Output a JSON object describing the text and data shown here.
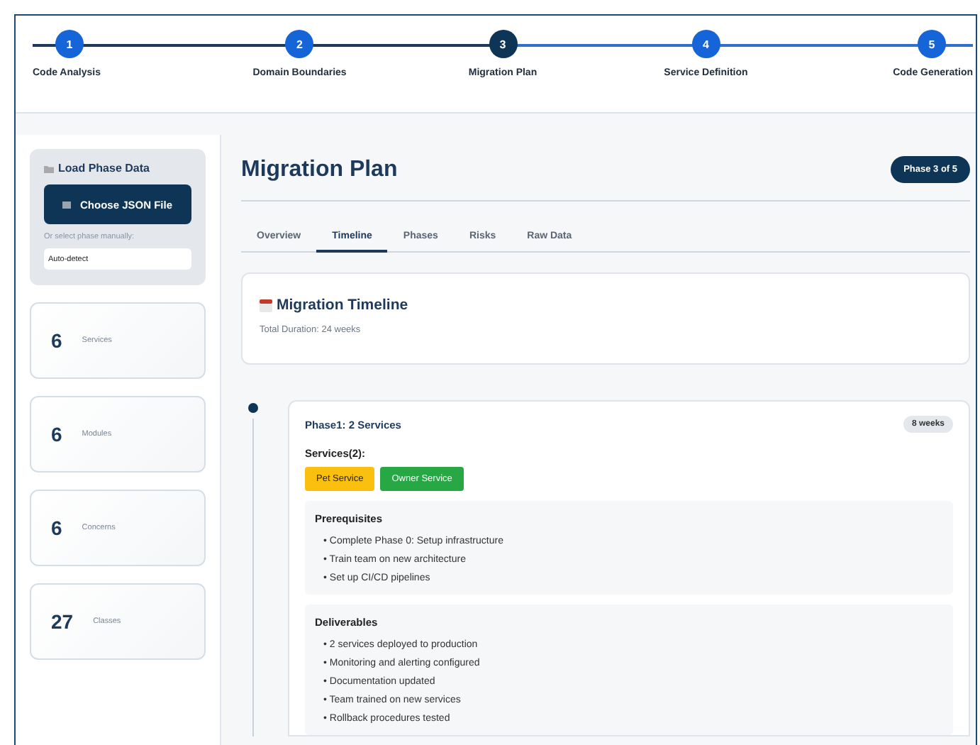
{
  "steps": [
    {
      "number": "1",
      "label": "Code Analysis",
      "selected": false
    },
    {
      "number": "2",
      "label": "Domain Boundaries",
      "selected": false
    },
    {
      "number": "3",
      "label": "Migration Plan",
      "selected": true
    },
    {
      "number": "4",
      "label": "Service Definition",
      "selected": false
    },
    {
      "number": "5",
      "label": "Code Generation",
      "selected": false
    }
  ],
  "sidebar": {
    "load_panel": {
      "title": "Load Phase Data",
      "button": "Choose JSON File",
      "select_label": "Or select phase manually:",
      "select_value": "Auto-detect"
    },
    "stats": [
      {
        "value": "6",
        "label": "Services"
      },
      {
        "value": "6",
        "label": "Modules"
      },
      {
        "value": "6",
        "label": "Concerns"
      },
      {
        "value": "27",
        "label": "Classes"
      }
    ]
  },
  "main": {
    "title": "Migration Plan",
    "badge": "Phase 3 of 5",
    "tabs": [
      {
        "label": "Overview",
        "selected": false
      },
      {
        "label": "Timeline",
        "selected": true
      },
      {
        "label": "Phases",
        "selected": false
      },
      {
        "label": "Risks",
        "selected": false
      },
      {
        "label": "Raw Data",
        "selected": false
      }
    ],
    "timeline_card": {
      "title": "Migration Timeline",
      "duration": "Total Duration: 24 weeks"
    },
    "phase": {
      "title": "Phase1: 2 Services",
      "duration": "8 weeks",
      "services_label": "Services(2):",
      "services": [
        {
          "name": "Pet Service",
          "color": "#fbbf0f"
        },
        {
          "name": "Owner Service",
          "color": "#28a745"
        }
      ],
      "sections": [
        {
          "title": "Prerequisites",
          "items": [
            "• Complete Phase 0: Setup infrastructure",
            "• Train team on new architecture",
            "• Set up CI/CD pipelines"
          ]
        },
        {
          "title": "Deliverables",
          "items": [
            "• 2 services deployed to production",
            "• Monitoring and alerting configured",
            "• Documentation updated",
            "• Team trained on new services",
            "• Rollback procedures tested"
          ]
        }
      ]
    }
  }
}
